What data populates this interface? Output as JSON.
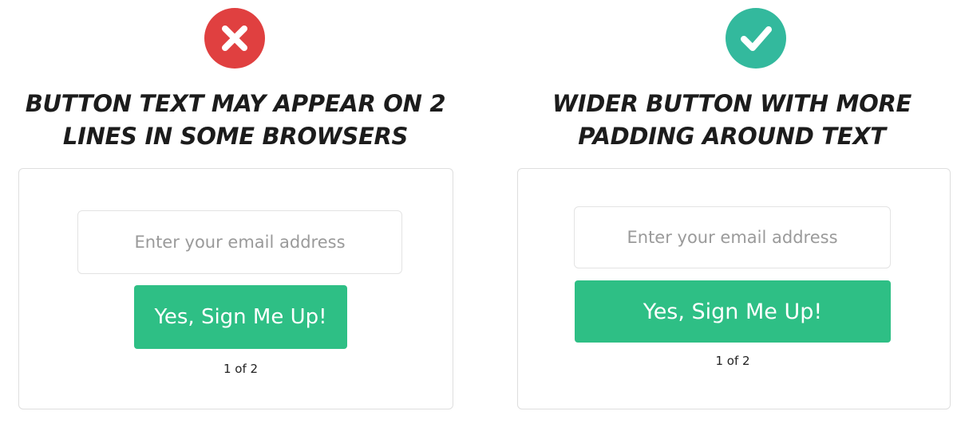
{
  "colors": {
    "bad_badge": "#e04040",
    "good_badge": "#33b99d",
    "button": "#2ebf85"
  },
  "panels": [
    {
      "icon": "x-mark-icon",
      "heading_line1": "BUTTON TEXT MAY APPEAR ON 2",
      "heading_line2": "LINES IN SOME BROWSERS",
      "form": {
        "email_placeholder": "Enter your email address",
        "button_label": "Yes, Sign Me Up!",
        "step": "1 of 2"
      }
    },
    {
      "icon": "check-mark-icon",
      "heading_line1": "WIDER BUTTON WITH MORE",
      "heading_line2": "PADDING AROUND TEXT",
      "form": {
        "email_placeholder": "Enter your email address",
        "button_label": "Yes, Sign Me Up!",
        "step": "1 of 2"
      }
    }
  ]
}
